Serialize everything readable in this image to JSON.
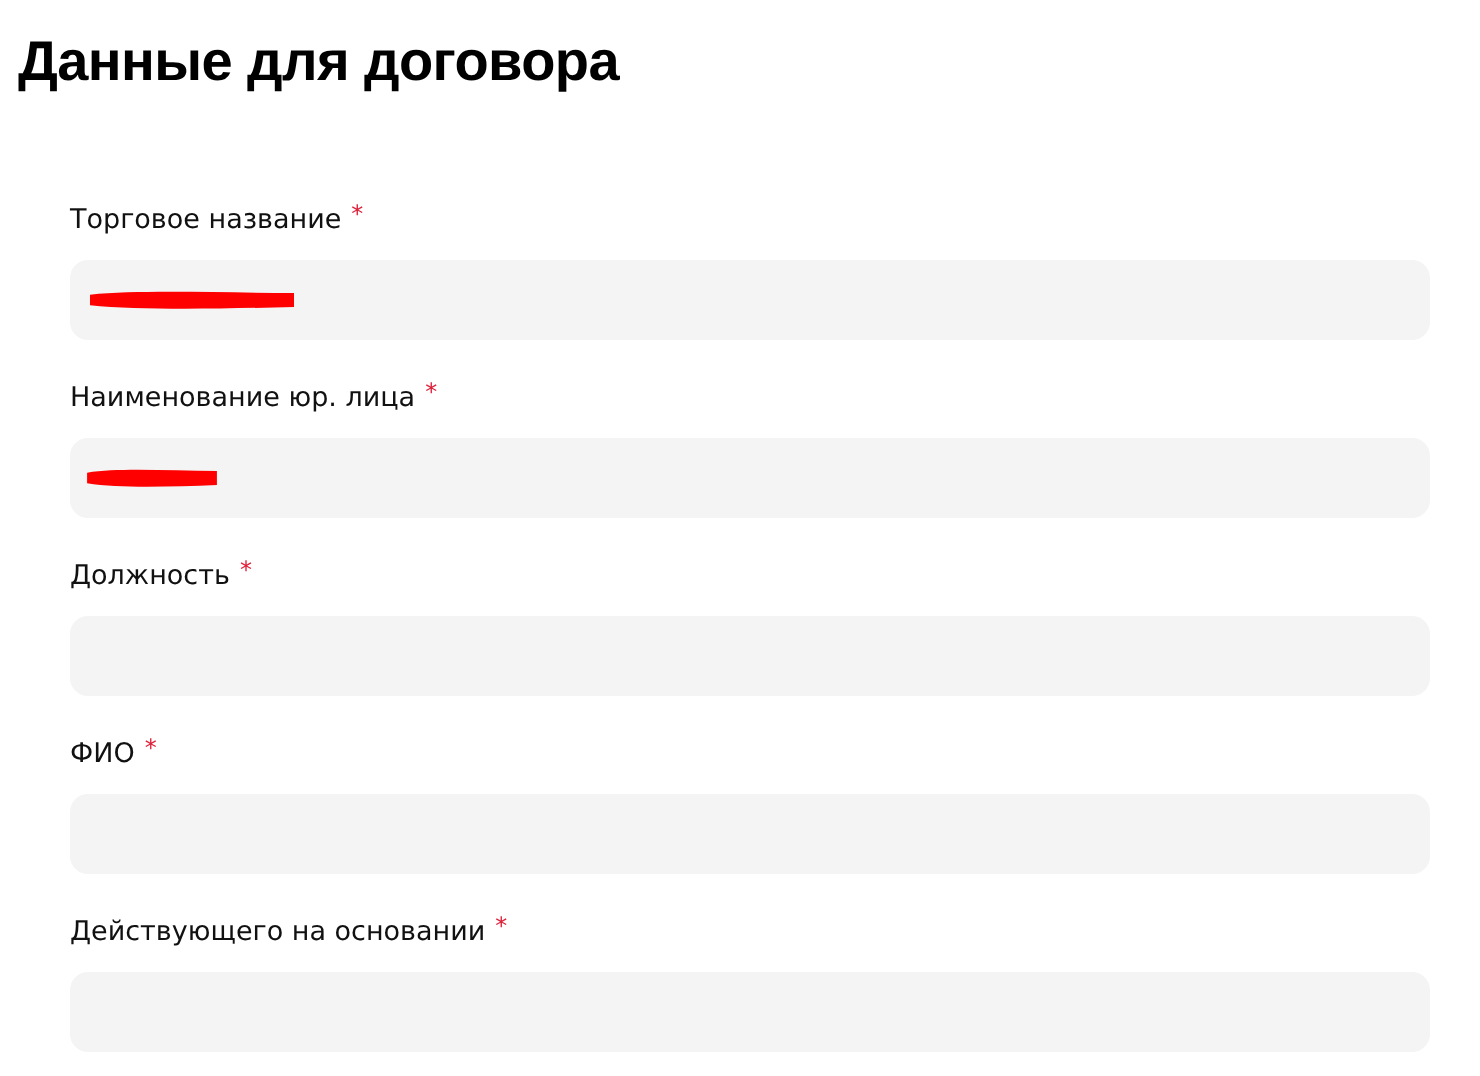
{
  "title": "Данные для договора",
  "fields": [
    {
      "label": "Торговое название",
      "required_mark": "*",
      "redacted": true
    },
    {
      "label": "Наименование юр. лица",
      "required_mark": "*",
      "redacted": true
    },
    {
      "label": "Должность",
      "required_mark": "*",
      "redacted": false
    },
    {
      "label": "ФИО",
      "required_mark": "*",
      "redacted": false
    },
    {
      "label": "Действующего на основании",
      "required_mark": "*",
      "redacted": false
    }
  ]
}
